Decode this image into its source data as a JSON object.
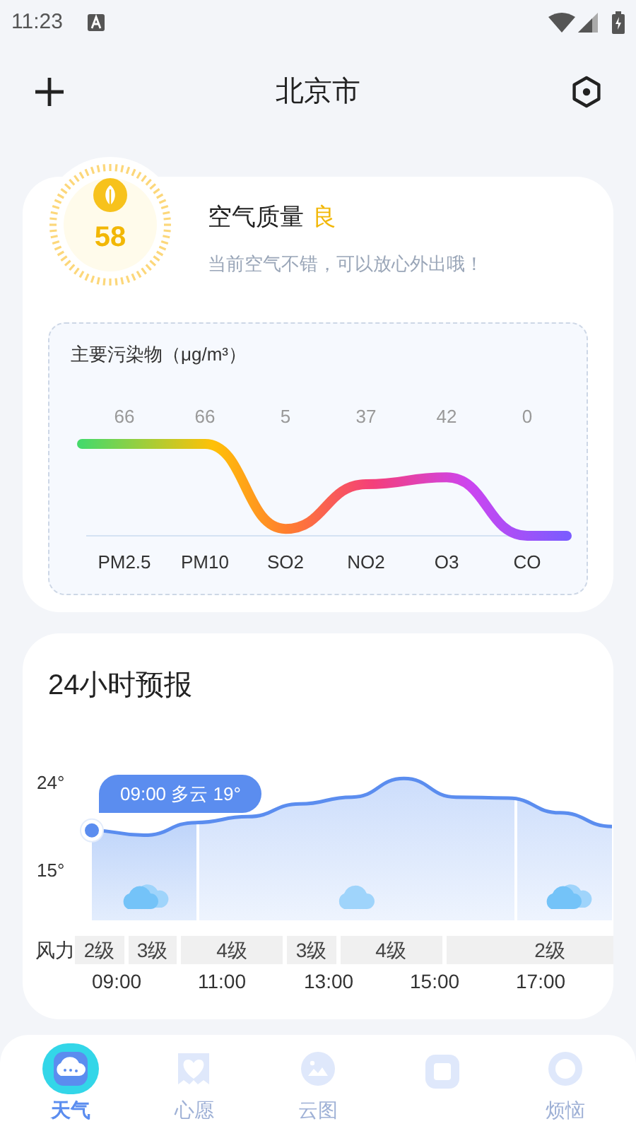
{
  "status_bar": {
    "time": "11:23"
  },
  "header": {
    "title": "北京市"
  },
  "air_quality": {
    "aqi": "58",
    "label": "空气质量",
    "grade": "良",
    "message": "当前空气不错，可以放心外出哦！",
    "pollutants": {
      "title": "主要污染物（μg/m³）",
      "items": [
        {
          "name": "PM2.5",
          "value": "66"
        },
        {
          "name": "PM10",
          "value": "66"
        },
        {
          "name": "SO2",
          "value": "5"
        },
        {
          "name": "NO2",
          "value": "37"
        },
        {
          "name": "O3",
          "value": "42"
        },
        {
          "name": "CO",
          "value": "0"
        }
      ]
    }
  },
  "forecast": {
    "title": "24小时预报",
    "tooltip": "09:00 多云 19°",
    "chart_data": {
      "type": "line",
      "ylim": [
        9.8,
        25.7
      ],
      "series": [
        {
          "color": "#5b8def",
          "values": [
            19,
            18.5,
            19.8,
            20.4,
            21.7,
            22.4,
            24.3,
            22.4,
            22.3,
            20.8,
            19.4
          ]
        }
      ],
      "yticks": [
        {
          "value": 15,
          "label": "15°"
        },
        {
          "value": 24,
          "label": "24°"
        }
      ]
    },
    "segments": [
      {
        "kind": "partly",
        "selected": true
      },
      {
        "kind": "cloudy",
        "selected": false
      },
      {
        "kind": "partly",
        "selected": false
      }
    ],
    "wind_label": "风力",
    "wind": [
      {
        "text": "2级",
        "kind": "narrow"
      },
      {
        "text": "3级",
        "kind": "narrow"
      },
      {
        "text": "4级",
        "kind": "wide"
      },
      {
        "text": "3级",
        "kind": "narrow"
      },
      {
        "text": "4级",
        "kind": "wide"
      },
      {
        "text": "2级",
        "kind": "rest"
      }
    ],
    "times": [
      "09:00",
      "11:00",
      "13:00",
      "15:00",
      "17:00"
    ]
  },
  "nav": [
    {
      "label": "天气",
      "kind": "cloud",
      "selected": true
    },
    {
      "label": "心愿",
      "kind": "heart",
      "selected": false
    },
    {
      "label": "云图",
      "kind": "image",
      "selected": false
    },
    {
      "kind": "tag",
      "selected": false
    },
    {
      "label": "烦恼",
      "kind": "face",
      "selected": false
    }
  ]
}
